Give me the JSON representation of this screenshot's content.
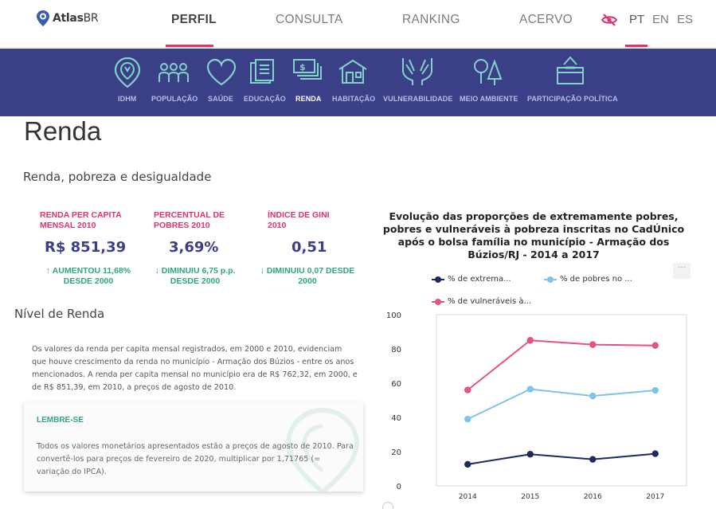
{
  "brand": {
    "name_bold": "Atlas",
    "name_light": "BR"
  },
  "topnav": {
    "items": [
      {
        "label": "PERFIL",
        "active": true
      },
      {
        "label": "CONSULTA",
        "active": false
      },
      {
        "label": "RANKING",
        "active": false
      },
      {
        "label": "ACERVO",
        "active": false
      }
    ],
    "languages": [
      {
        "label": "PT",
        "active": true
      },
      {
        "label": "EN",
        "active": false
      },
      {
        "label": "ES",
        "active": false
      }
    ],
    "accent_color": "#e0326e"
  },
  "categories": [
    {
      "label": "IDHM",
      "icon": "idhm-icon"
    },
    {
      "label": "POPULAÇÃO",
      "icon": "population-icon"
    },
    {
      "label": "SAÚDE",
      "icon": "heart-icon"
    },
    {
      "label": "EDUCAÇÃO",
      "icon": "book-icon"
    },
    {
      "label": "RENDA",
      "icon": "money-icon",
      "active": true
    },
    {
      "label": "HABITAÇÃO",
      "icon": "house-icon"
    },
    {
      "label": "VULNERABILIDADE",
      "icon": "hands-icon"
    },
    {
      "label": "MEIO AMBIENTE",
      "icon": "trees-icon"
    },
    {
      "label": "PARTICIPAÇÃO POLÍTICA",
      "icon": "ballot-box-icon"
    }
  ],
  "page": {
    "title": "Renda",
    "section_title": "Renda, pobreza e desigualdade",
    "kpis": [
      {
        "label": "RENDA PER CAPITA MENSAL 2010",
        "value": "R$ 851,39",
        "change": "↑ AUMENTOU 11,68% DESDE 2000"
      },
      {
        "label": "PERCENTUAL DE POBRES 2010",
        "value": "3,69%",
        "change": "↓ DIMINUIU 6,75 p.p. DESDE 2000"
      },
      {
        "label": "ÍNDICE DE GINI 2010",
        "value": "0,51",
        "change": "↓ DIMINUIU 0,07 DESDE 2000"
      }
    ],
    "sub_title": "Nível de Renda",
    "paragraph": "Os valores da renda per capita mensal registrados, em 2000 e 2010, evidenciam que houve crescimento da renda no município - Armação dos Búzios - entre os anos mencionados. A renda per capita mensal no município era de R$ 762,32, em 2000, e de R$ 851,39, em 2010, a preços de agosto de 2010.",
    "note": {
      "title": "LEMBRE-SE",
      "text": "Todos os valores monetários apresentados estão a preços de agosto de 2010. Para convertê-los para preços de fevereiro de 2020, multiplicar por 1,71765 (= variação do IPCA)."
    }
  },
  "chart_data": {
    "type": "line",
    "title": "Evolução das proporções de extremamente pobres, pobres e vulneráveis à pobreza inscritas no CadÚnico após o bolsa família no município - Armação dos Búzios/RJ - 2014 a 2017",
    "categories": [
      "2014",
      "2015",
      "2016",
      "2017"
    ],
    "series": [
      {
        "name": "% de extrema...",
        "color": "#1f2a5c",
        "values": [
          12.6,
          18.5,
          15.5,
          18.8
        ]
      },
      {
        "name": "% de pobres no ...",
        "color": "#7fc3e8",
        "values": [
          39.0,
          56.5,
          52.5,
          55.8
        ]
      },
      {
        "name": "% de vulneráveis à...",
        "color": "#e3528a",
        "values": [
          56.0,
          85.0,
          82.5,
          82.0
        ]
      }
    ],
    "ylim": [
      0,
      100
    ],
    "yticks": [
      0,
      20,
      40,
      60,
      80,
      100
    ],
    "grid": false,
    "legend_position": "top"
  }
}
